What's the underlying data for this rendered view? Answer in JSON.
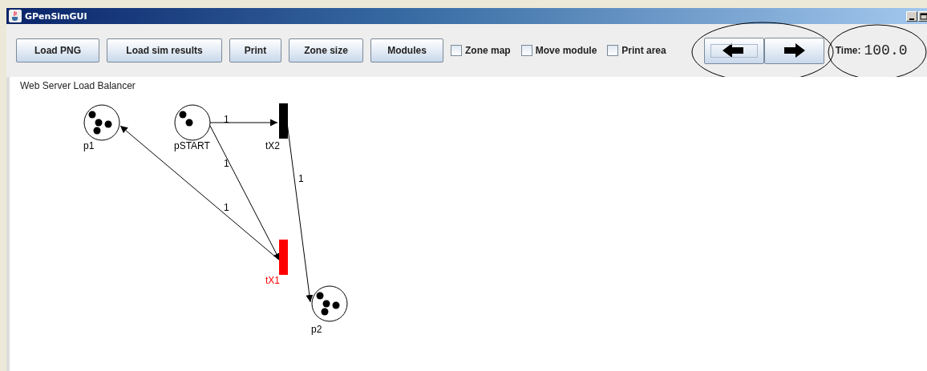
{
  "window": {
    "title": "GPenSimGUI"
  },
  "toolbar": {
    "buttons": [
      "Load PNG",
      "Load sim results",
      "Print",
      "Zone size",
      "Modules"
    ],
    "checkboxes": [
      {
        "label": "Zone map",
        "checked": false
      },
      {
        "label": "Move module",
        "checked": false
      },
      {
        "label": "Print area",
        "checked": false
      }
    ],
    "nav_buttons": [
      {
        "kind": "back",
        "focused": true
      },
      {
        "kind": "forward",
        "focused": false
      }
    ],
    "time": {
      "label": "Time:",
      "value": "100.0"
    }
  },
  "net": {
    "title": "Web Server Load Balancer",
    "places": [
      {
        "name": "p1",
        "tokens": [
          {
            "kind": "token"
          },
          {
            "kind": "token"
          },
          {
            "kind": "token"
          },
          {
            "kind": "token"
          }
        ]
      },
      {
        "name": "pSTART",
        "tokens": [
          {
            "kind": "token"
          },
          {
            "kind": "token"
          }
        ]
      },
      {
        "name": "p2",
        "tokens": [
          {
            "kind": "token"
          },
          {
            "kind": "token"
          },
          {
            "kind": "token"
          },
          {
            "kind": "token"
          }
        ]
      }
    ],
    "transitions": [
      {
        "name": "tX2",
        "firing": false
      },
      {
        "name": "tX1",
        "firing": true
      }
    ],
    "arcs": [
      {
        "weight": "1"
      },
      {
        "weight": "1"
      },
      {
        "weight": "1"
      },
      {
        "weight": "1"
      }
    ]
  }
}
